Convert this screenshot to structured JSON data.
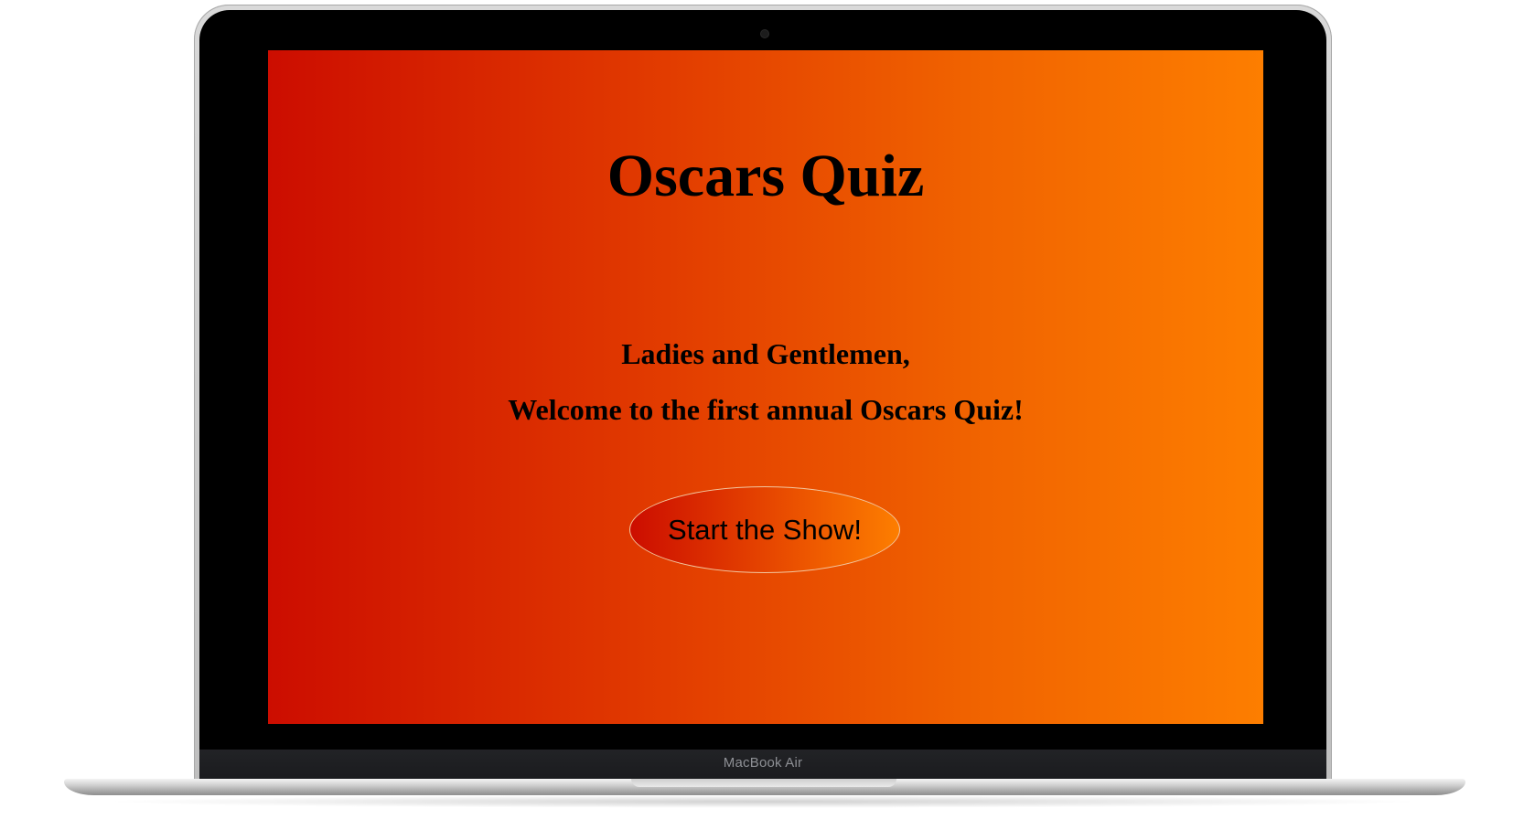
{
  "device": {
    "brand_label": "MacBook Air"
  },
  "quiz": {
    "title": "Oscars Quiz",
    "greeting": "Ladies and Gentlemen,",
    "welcome": "Welcome to the first annual Oscars Quiz!",
    "start_button_label": "Start the Show!"
  },
  "colors": {
    "gradient_start": "#cc0d00",
    "gradient_end": "#fd7e00",
    "text": "#000000"
  }
}
